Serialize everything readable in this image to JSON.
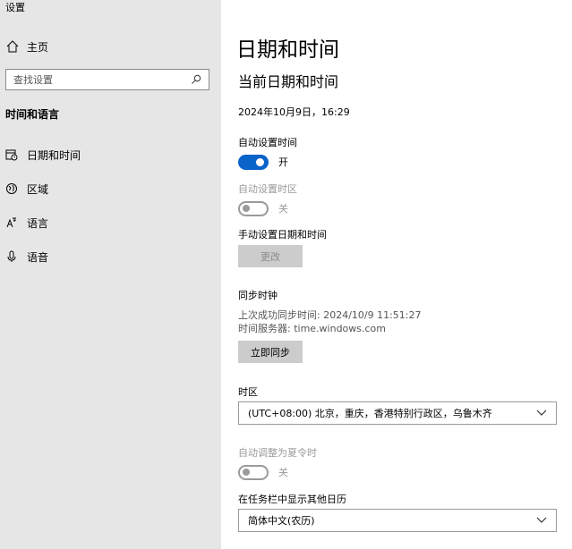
{
  "app": {
    "title": "设置"
  },
  "sidebar": {
    "home_label": "主页",
    "search_placeholder": "查找设置",
    "section_title": "时间和语言",
    "items": [
      {
        "label": "日期和时间",
        "icon": "date-time-icon"
      },
      {
        "label": "区域",
        "icon": "region-icon"
      },
      {
        "label": "语言",
        "icon": "language-icon"
      },
      {
        "label": "语音",
        "icon": "microphone-icon"
      }
    ]
  },
  "main": {
    "page_title": "日期和时间",
    "section_title": "当前日期和时间",
    "current_datetime": "2024年10月9日，16:29",
    "auto_time": {
      "label": "自动设置时间",
      "state": "开",
      "on": true
    },
    "auto_timezone": {
      "label": "自动设置时区",
      "state": "关",
      "on": false,
      "disabled": true
    },
    "manual": {
      "label": "手动设置日期和时间",
      "button": "更改"
    },
    "sync": {
      "title": "同步时钟",
      "last_sync": "上次成功同步时间: 2024/10/9 11:51:27",
      "server": "时间服务器: time.windows.com",
      "button": "立即同步"
    },
    "timezone": {
      "label": "时区",
      "value": "(UTC+08:00) 北京，重庆，香港特别行政区，乌鲁木齐"
    },
    "dst": {
      "label": "自动调整为夏令时",
      "state": "关",
      "on": false,
      "disabled": true
    },
    "calendar": {
      "label": "在任务栏中显示其他日历",
      "value": "简体中文(农历)"
    }
  },
  "colors": {
    "sidebar_bg": "#e6e6e6",
    "accent": "#0a63c9",
    "button_bg": "#cccccc"
  }
}
